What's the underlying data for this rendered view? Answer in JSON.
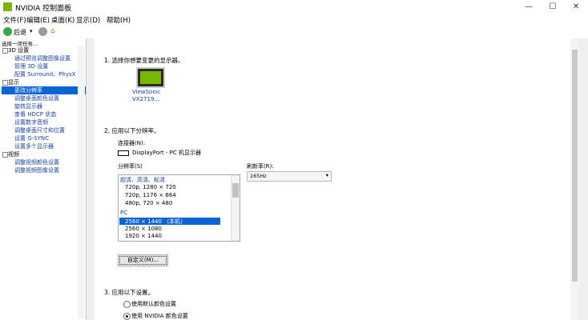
{
  "window": {
    "title": "NVIDIA 控制面板",
    "minimize": "—",
    "maximize": "☐",
    "close": "✕"
  },
  "menu": [
    "文件(F)",
    "编辑(E)",
    "桌面(K)",
    "显示(D)",
    "帮助(H)"
  ],
  "toolbar": {
    "back_label": "后退"
  },
  "left": {
    "task_header": "选择一项任务...",
    "tree": [
      {
        "type": "cat",
        "label": "3D 设置"
      },
      {
        "type": "item",
        "label": "通过预览调整图像设置"
      },
      {
        "type": "item",
        "label": "管理 3D 设置"
      },
      {
        "type": "item",
        "label": "配置 Surround、PhysX"
      },
      {
        "type": "cat",
        "label": "显示"
      },
      {
        "type": "item",
        "label": "更改分辨率",
        "selected": true
      },
      {
        "type": "item",
        "label": "调整桌面颜色设置"
      },
      {
        "type": "item",
        "label": "旋转显示器"
      },
      {
        "type": "item",
        "label": "查看 HDCP 状态"
      },
      {
        "type": "item",
        "label": "设置数字音频"
      },
      {
        "type": "item",
        "label": "调整桌面尺寸和位置"
      },
      {
        "type": "item",
        "label": "设置 G-SYNC"
      },
      {
        "type": "item",
        "label": "设置多个显示器"
      },
      {
        "type": "cat",
        "label": "视频"
      },
      {
        "type": "item",
        "label": "调整视频颜色设置"
      },
      {
        "type": "item",
        "label": "调整视频图像设置"
      }
    ]
  },
  "main": {
    "section1": "1.  选择你想要变更的显示器。",
    "monitor_name_line1": "ViewSonic",
    "monitor_name_line2": "VX2719...",
    "section2": "2.  应用以下分辨率。",
    "connector_label": "连接器(N):",
    "connector_value": "DisplayPort - PC 机显示器",
    "resolution_label": "分辨率(S)",
    "refresh_label": "刷新率(R):",
    "refresh_value": "165Hz",
    "list": {
      "group1": "超清、高清、标清",
      "items1": [
        "720p, 1280 × 720",
        "720p, 1176 × 664",
        "480p, 720 × 480"
      ],
      "group2": "PC",
      "items2": [
        "2560 × 1440 （本机）",
        "2560 × 1080",
        "1920 × 1440"
      ]
    },
    "custom_button": "自定义(M)...",
    "section3": "3.  应用以下设置。",
    "radio1": "使用默认颜色设置",
    "radio2": "使用 NVIDIA 颜色设置"
  },
  "colors": {
    "accent": "#76b900",
    "selection": "#0a64d6",
    "link": "#1a3f9e"
  }
}
